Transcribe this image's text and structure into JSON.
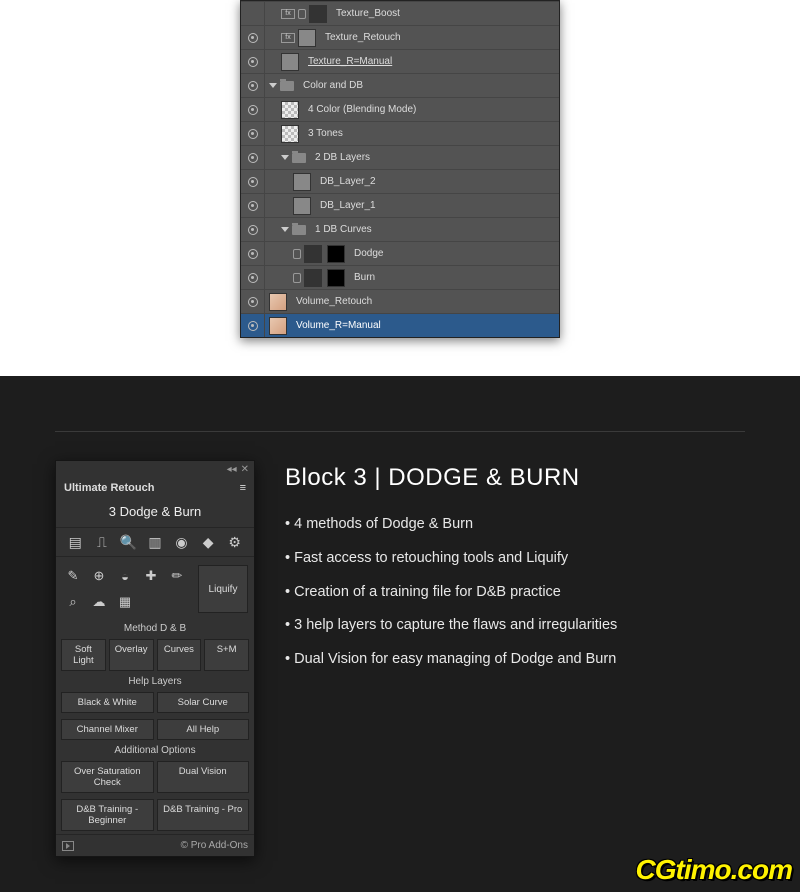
{
  "layers": [
    {
      "vis": false,
      "depth": 1,
      "type": "adj",
      "mask": "",
      "label": "Texture_Boost",
      "fx": true,
      "link": true,
      "under": false
    },
    {
      "vis": true,
      "depth": 1,
      "type": "thumb",
      "mask": "",
      "label": "Texture_Retouch",
      "fx": true,
      "link": false,
      "under": false
    },
    {
      "vis": true,
      "depth": 1,
      "type": "thumb",
      "mask": "",
      "label": "Texture_R=Manual",
      "fx": false,
      "link": false,
      "under": true
    },
    {
      "vis": true,
      "depth": 0,
      "type": "group",
      "open": true,
      "label": "Color and DB",
      "fx": false,
      "link": false,
      "under": false
    },
    {
      "vis": true,
      "depth": 1,
      "type": "chk",
      "mask": "",
      "label": "4 Color (Blending Mode)",
      "fx": false,
      "link": false,
      "under": false
    },
    {
      "vis": true,
      "depth": 1,
      "type": "chk",
      "mask": "",
      "label": "3 Tones",
      "fx": false,
      "link": false,
      "under": false
    },
    {
      "vis": true,
      "depth": 1,
      "type": "group",
      "open": true,
      "label": "2 DB Layers",
      "fx": false,
      "link": false,
      "under": false
    },
    {
      "vis": true,
      "depth": 2,
      "type": "thumb",
      "mask": "",
      "label": "DB_Layer_2",
      "fx": false,
      "link": false,
      "under": false
    },
    {
      "vis": true,
      "depth": 2,
      "type": "thumb",
      "mask": "",
      "label": "DB_Layer_1",
      "fx": false,
      "link": false,
      "under": false
    },
    {
      "vis": true,
      "depth": 1,
      "type": "group",
      "open": true,
      "label": "1 DB Curves",
      "fx": false,
      "link": false,
      "under": false
    },
    {
      "vis": true,
      "depth": 2,
      "type": "adj",
      "mask": "blk",
      "label": "Dodge",
      "fx": false,
      "link": true,
      "under": false
    },
    {
      "vis": true,
      "depth": 2,
      "type": "adj",
      "mask": "blk",
      "label": "Burn",
      "fx": false,
      "link": true,
      "under": false
    },
    {
      "vis": true,
      "depth": 0,
      "type": "photo",
      "mask": "",
      "label": "Volume_Retouch",
      "fx": false,
      "link": false,
      "under": false
    },
    {
      "vis": true,
      "depth": 0,
      "type": "photo",
      "mask": "",
      "label": "Volume_R=Manual",
      "fx": false,
      "link": false,
      "under": false,
      "sel": true
    }
  ],
  "plugin": {
    "title": "Ultimate Retouch",
    "subtitle": "3 Dodge & Burn",
    "nav_icons": [
      "doc",
      "pulse",
      "search",
      "layers",
      "venn",
      "gem",
      "gear"
    ],
    "nav_active": 2,
    "tools": [
      "brush",
      "stamp",
      "patch",
      "heal",
      "pencil",
      "zoom",
      "smudge",
      "chip",
      "",
      ""
    ],
    "liquify": "Liquify",
    "section_method": "Method D & B",
    "method_buttons": [
      "Soft Light",
      "Overlay",
      "Curves",
      "S+M"
    ],
    "section_help": "Help Layers",
    "help_buttons_1": [
      "Black & White",
      "Solar Curve"
    ],
    "help_buttons_2": [
      "Channel Mixer",
      "All Help"
    ],
    "section_addl": "Additional Options",
    "addl_buttons_1": [
      "Over Saturation Check",
      "Dual Vision"
    ],
    "addl_buttons_2": [
      "D&B Training - Beginner",
      "D&B Training - Pro"
    ],
    "footer": "© Pro Add-Ons"
  },
  "article": {
    "heading": "Block 3 | DODGE & BURN",
    "bullets": [
      "4 methods of Dodge & Burn",
      "Fast access to retouching tools and Liquify",
      "Creation of a training file for D&B practice",
      "3 help layers to capture the flaws and irregularities",
      "Dual Vision for easy managing of Dodge and Burn"
    ]
  },
  "watermark": "CGtimo.com"
}
